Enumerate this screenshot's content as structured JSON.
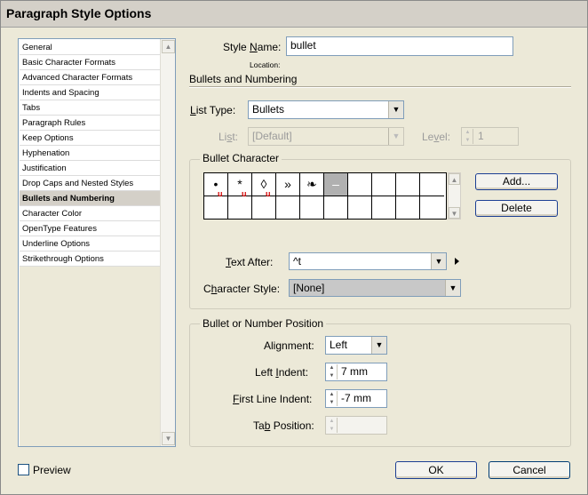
{
  "window": {
    "title": "Paragraph Style Options"
  },
  "sidebar": {
    "items": [
      {
        "label": "General"
      },
      {
        "label": "Basic Character Formats"
      },
      {
        "label": "Advanced Character Formats"
      },
      {
        "label": "Indents and Spacing"
      },
      {
        "label": "Tabs"
      },
      {
        "label": "Paragraph Rules"
      },
      {
        "label": "Keep Options"
      },
      {
        "label": "Hyphenation"
      },
      {
        "label": "Justification"
      },
      {
        "label": "Drop Caps and Nested Styles"
      },
      {
        "label": "Bullets and Numbering",
        "selected": true
      },
      {
        "label": "Character Color"
      },
      {
        "label": "OpenType Features"
      },
      {
        "label": "Underline Options"
      },
      {
        "label": "Strikethrough Options"
      }
    ]
  },
  "style": {
    "name_label_pre": "Style ",
    "name_label_key": "N",
    "name_label_post": "ame:",
    "name_value": "bullet",
    "location_label": "Location:"
  },
  "section": {
    "title": "Bullets and Numbering"
  },
  "list_type": {
    "label_key": "L",
    "label_post": "ist Type:",
    "value": "Bullets"
  },
  "list": {
    "label_pre": "Li",
    "label_key": "s",
    "label_post": "t:",
    "value": "[Default]"
  },
  "level": {
    "label_pre": "Le",
    "label_key": "v",
    "label_post": "el:",
    "value": "1"
  },
  "bullet_character": {
    "group_title": "Bullet Character",
    "glyphs": [
      {
        "char": "•",
        "mark": "u"
      },
      {
        "char": "*",
        "mark": "u"
      },
      {
        "char": "◊",
        "mark": "u"
      },
      {
        "char": "»",
        "mark": ""
      },
      {
        "char": "❧",
        "mark": ""
      },
      {
        "char": "–",
        "mark": "",
        "selected": true
      }
    ],
    "add_label": "Add...",
    "delete_label": "Delete"
  },
  "text_after": {
    "label_key": "T",
    "label_post": "ext After:",
    "value": "^t"
  },
  "character_style": {
    "label_pre": "C",
    "label_key": "h",
    "label_post": "aracter Style:",
    "value": "[None]"
  },
  "position": {
    "group_title": "Bullet or Number Position",
    "alignment": {
      "label_pre": "Ali",
      "label_key": "g",
      "label_post": "nment:",
      "value": "Left"
    },
    "left_indent": {
      "label_pre": "Left ",
      "label_key": "I",
      "label_post": "ndent:",
      "value": "7 mm"
    },
    "first_line_indent": {
      "label_pre": "",
      "label_key": "F",
      "label_post": "irst Line Indent:",
      "value": "-7 mm"
    },
    "tab_position": {
      "label_pre": "Ta",
      "label_key": "b",
      "label_post": " Position:",
      "value": ""
    }
  },
  "footer": {
    "preview_label": "Preview",
    "ok_label": "OK",
    "cancel_label": "Cancel"
  }
}
